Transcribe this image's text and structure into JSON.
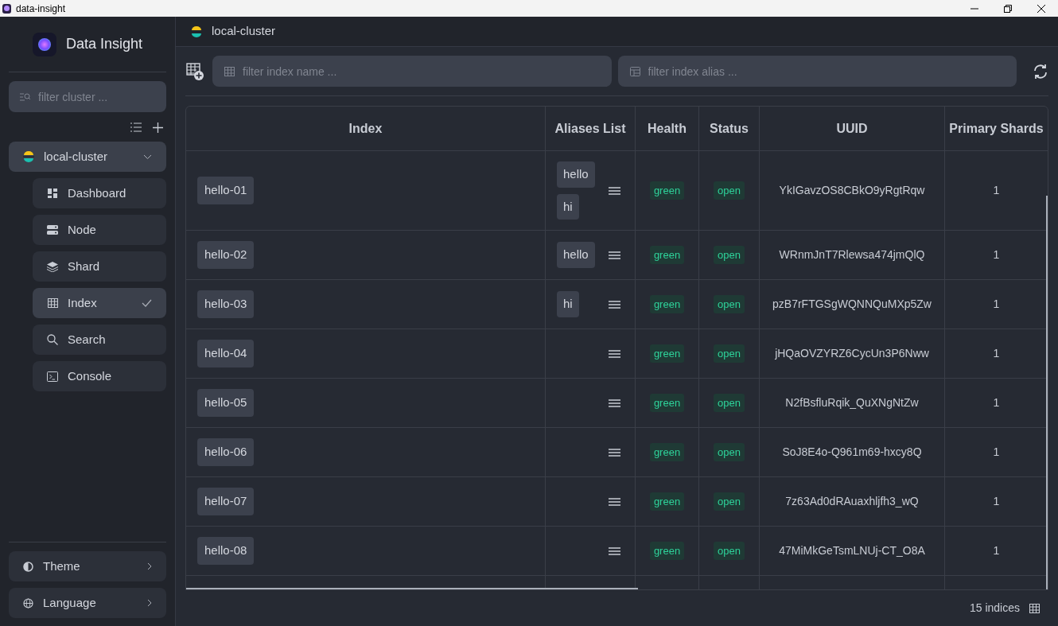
{
  "window": {
    "title": "data-insight"
  },
  "sidebar": {
    "app_name": "Data Insight",
    "filter": {
      "placeholder": "filter cluster ..."
    },
    "cluster": {
      "name": "local-cluster",
      "expanded": true,
      "items": [
        {
          "label": "Dashboard",
          "selected": false
        },
        {
          "label": "Node",
          "selected": false
        },
        {
          "label": "Shard",
          "selected": false
        },
        {
          "label": "Index",
          "selected": true
        },
        {
          "label": "Search",
          "selected": false
        },
        {
          "label": "Console",
          "selected": false
        }
      ]
    },
    "bottom": [
      {
        "label": "Theme"
      },
      {
        "label": "Language"
      }
    ]
  },
  "header": {
    "cluster": "local-cluster"
  },
  "toolbar": {
    "name_filter": {
      "placeholder": "filter index name ..."
    },
    "alias_filter": {
      "placeholder": "filter index alias ..."
    }
  },
  "table": {
    "columns": [
      "Index",
      "Aliases List",
      "Health",
      "Status",
      "UUID",
      "Primary Shards"
    ],
    "rows": [
      {
        "index": "hello-01",
        "aliases": [
          "hello",
          "hi"
        ],
        "health": "green",
        "status": "open",
        "uuid": "YkIGavzOS8CBkO9yRgtRqw",
        "primary_shards": "1"
      },
      {
        "index": "hello-02",
        "aliases": [
          "hello"
        ],
        "health": "green",
        "status": "open",
        "uuid": "WRnmJnT7Rlewsa474jmQlQ",
        "primary_shards": "1"
      },
      {
        "index": "hello-03",
        "aliases": [
          "hi"
        ],
        "health": "green",
        "status": "open",
        "uuid": "pzB7rFTGSgWQNNQuMXp5Zw",
        "primary_shards": "1"
      },
      {
        "index": "hello-04",
        "aliases": [],
        "health": "green",
        "status": "open",
        "uuid": "jHQaOVZYRZ6CycUn3P6Nww",
        "primary_shards": "1"
      },
      {
        "index": "hello-05",
        "aliases": [],
        "health": "green",
        "status": "open",
        "uuid": "N2fBsfluRqik_QuXNgNtZw",
        "primary_shards": "1"
      },
      {
        "index": "hello-06",
        "aliases": [],
        "health": "green",
        "status": "open",
        "uuid": "SoJ8E4o-Q961m69-hxcy8Q",
        "primary_shards": "1"
      },
      {
        "index": "hello-07",
        "aliases": [],
        "health": "green",
        "status": "open",
        "uuid": "7z63Ad0dRAuaxhljfh3_wQ",
        "primary_shards": "1"
      },
      {
        "index": "hello-08",
        "aliases": [],
        "health": "green",
        "status": "open",
        "uuid": "47MiMkGeTsmLNUj-CT_O8A",
        "primary_shards": "1"
      }
    ]
  },
  "footer": {
    "count": "15 indices"
  }
}
